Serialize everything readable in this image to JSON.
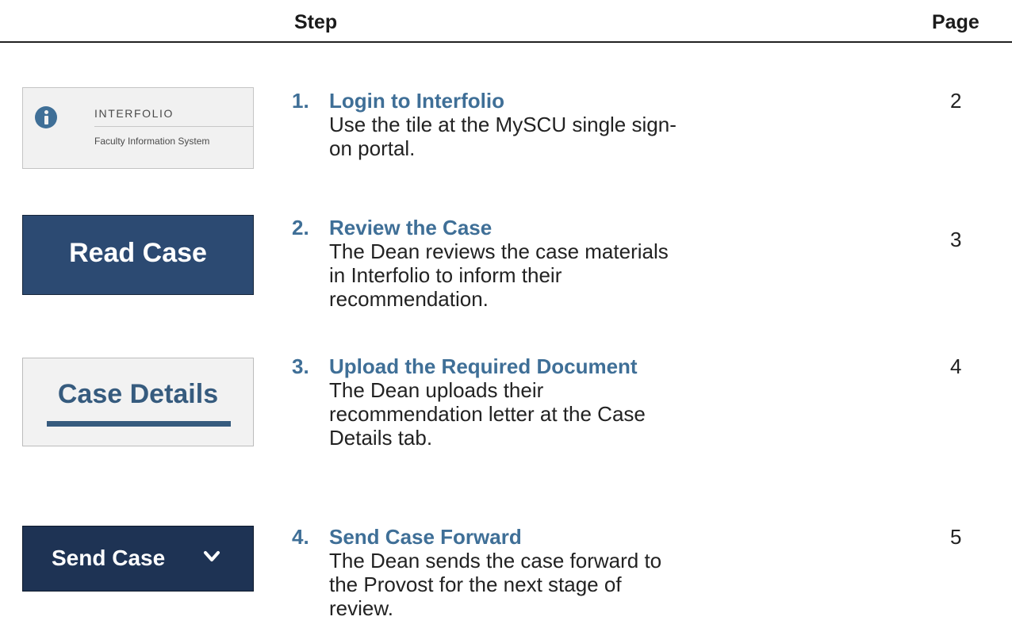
{
  "header": {
    "step_label": "Step",
    "page_label": "Page"
  },
  "thumbnails": {
    "login": {
      "icon": "info-circle-icon",
      "title": "INTERFOLIO",
      "subtitle": "Faculty Information System"
    },
    "read_case": {
      "label": "Read Case"
    },
    "case_details": {
      "label": "Case Details"
    },
    "send_case": {
      "label": "Send Case",
      "icon": "chevron-down-icon"
    }
  },
  "steps": [
    {
      "number": "1.",
      "title": "Login to Interfolio",
      "description": "Use the tile at the MySCU single sign-on portal.",
      "page": "2"
    },
    {
      "number": "2.",
      "title": "Review the Case",
      "description": "The Dean reviews the case materials in Interfolio to inform their recommendation.",
      "page": "3"
    },
    {
      "number": "3.",
      "title": "Upload the Required Document",
      "description": "The Dean uploads their recommendation letter at the Case Details tab.",
      "page": "4"
    },
    {
      "number": "4.",
      "title": "Send Case Forward",
      "description": "The Dean sends the case forward to the Provost for the next stage of review.",
      "page": "5"
    }
  ],
  "colors": {
    "title_blue": "#3f6f97",
    "read_case_bg": "#2c4a72",
    "send_case_bg": "#1e3354",
    "details_text": "#365b7e"
  }
}
